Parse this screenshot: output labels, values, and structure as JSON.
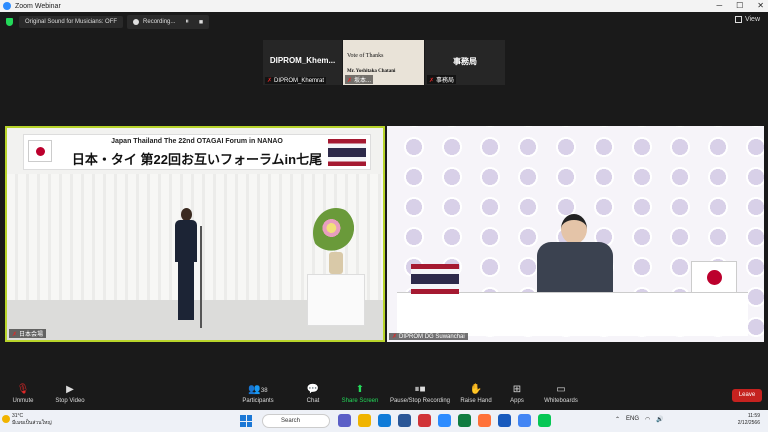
{
  "window": {
    "title": "Zoom Webinar"
  },
  "topbar": {
    "audio_label": "Original Sound for Musicians: OFF",
    "recording_label": "Recording...",
    "view_label": "View"
  },
  "participants": [
    {
      "name": "DIPROM_Khem...",
      "label": "DIPROM_Khemrat"
    },
    {
      "slide_title": "Vote of Thanks",
      "slide_name": "Mr. Yoshitaka Chatani",
      "label": "坂本..."
    },
    {
      "name": "事務局",
      "label": "事務局"
    }
  ],
  "left_video": {
    "banner_line1": "Japan Thailand The 22nd OTAGAI Forum in NANAO",
    "banner_line2": "日本・タイ 第22回お互いフォーラムin七尾",
    "name": "日本会場"
  },
  "right_video": {
    "name": "DIPROM DG Suwanchai"
  },
  "toolbar": {
    "unmute": "Unmute",
    "stop_video": "Stop Video",
    "participants": "Participants",
    "participants_count": "38",
    "chat": "Chat",
    "share_screen": "Share Screen",
    "pause_recording": "Pause/Stop Recording",
    "raise_hand": "Raise Hand",
    "apps": "Apps",
    "whiteboards": "Whiteboards",
    "leave": "Leave"
  },
  "taskbar": {
    "weather_temp": "31°C",
    "weather_desc": "มีเมฆเป็นส่วนใหญ่",
    "search": "Search",
    "lang": "ENG",
    "time": "11:59",
    "date": "2/12/2566"
  }
}
